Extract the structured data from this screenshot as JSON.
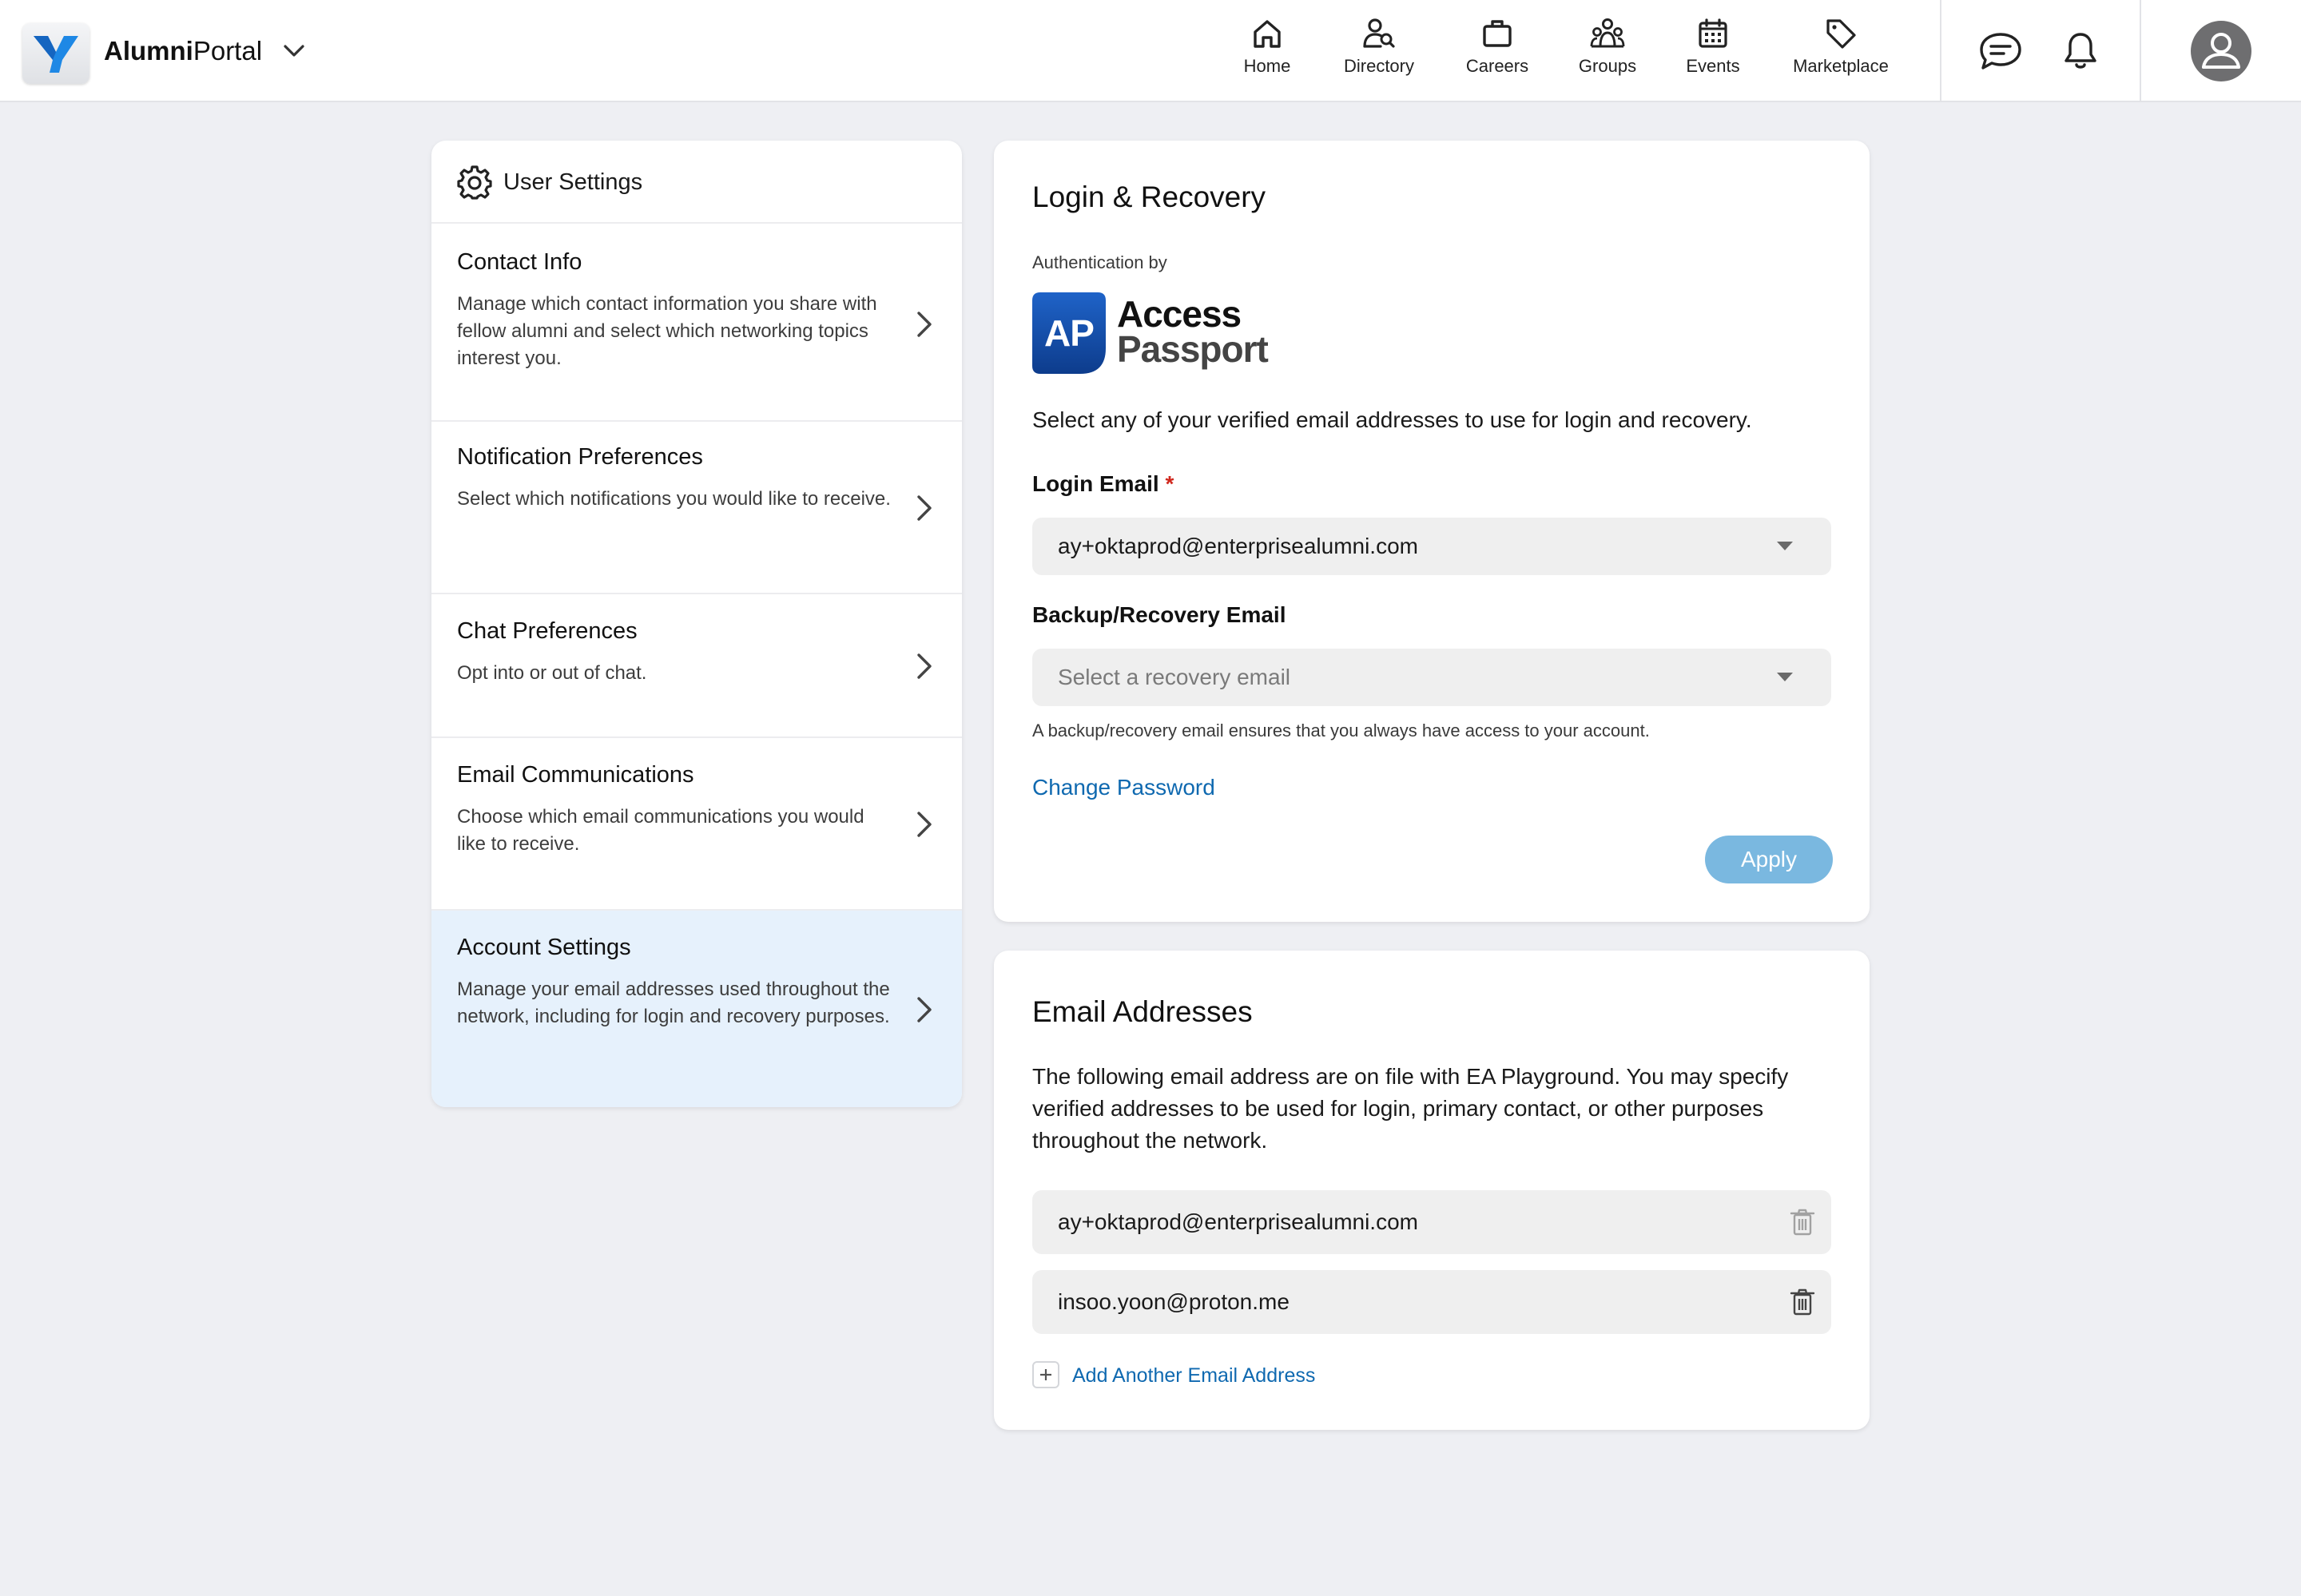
{
  "header": {
    "app_name_bold": "Alumni",
    "app_name_rest": "Portal",
    "nav": [
      {
        "label": "Home",
        "icon": "home-icon"
      },
      {
        "label": "Directory",
        "icon": "directory-icon"
      },
      {
        "label": "Careers",
        "icon": "briefcase-icon"
      },
      {
        "label": "Groups",
        "icon": "groups-icon"
      },
      {
        "label": "Events",
        "icon": "calendar-icon"
      },
      {
        "label": "Marketplace",
        "icon": "tag-icon"
      }
    ]
  },
  "sidebar": {
    "title": "User Settings",
    "items": [
      {
        "title": "Contact Info",
        "description": "Manage which contact information you share with fellow alumni and select which networking topics interest you."
      },
      {
        "title": "Notification Preferences",
        "description": "Select which notifications you would like to receive."
      },
      {
        "title": "Chat Preferences",
        "description": "Opt into or out of chat."
      },
      {
        "title": "Email Communications",
        "description": "Choose which email communications you would like to receive."
      },
      {
        "title": "Account Settings",
        "description": "Manage your email addresses used throughout the network, including for login and recovery purposes.",
        "active": true
      }
    ]
  },
  "login_recovery": {
    "title": "Login & Recovery",
    "auth_by_label": "Authentication by",
    "auth_logo": {
      "mark": "AP",
      "word1": "Access",
      "word2": "Passport"
    },
    "intro": "Select any of your verified email addresses to use for login and recovery.",
    "login_email_label": "Login Email",
    "required_mark": "*",
    "login_email_value": "ay+oktaprod@enterprisealumni.com",
    "backup_label": "Backup/Recovery Email",
    "backup_placeholder": "Select a recovery email",
    "backup_help": "A backup/recovery email ensures that you always have access to your account.",
    "change_password": "Change Password",
    "apply": "Apply"
  },
  "email_addresses": {
    "title": "Email Addresses",
    "intro": "The following email address are on file with EA Playground. You may specify verified addresses to be used for login, primary contact, or other purposes throughout the network.",
    "emails": [
      "ay+oktaprod@enterprisealumni.com",
      "insoo.yoon@proton.me"
    ],
    "add_label": "Add Another Email Address"
  },
  "colors": {
    "background": "#eeeff3",
    "link": "#0f69b0",
    "apply_button": "#7ab8e0",
    "active_item": "#e6f1fc",
    "required": "#d0271d",
    "brand_blue": "#1565c0"
  }
}
